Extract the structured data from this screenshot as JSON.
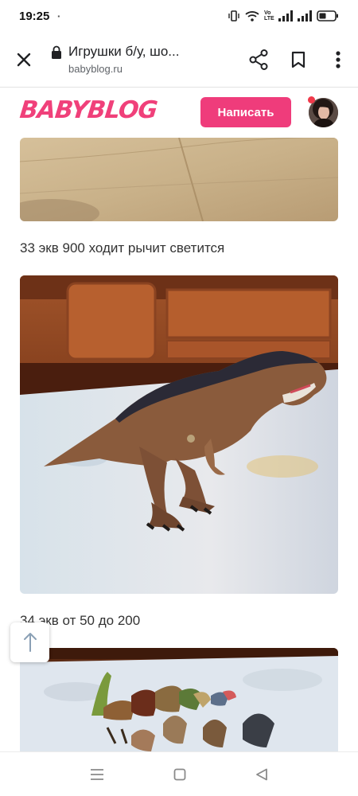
{
  "status_bar": {
    "time": "19:25",
    "notification_glyph": "▪",
    "volte_label": "Vo LTE",
    "icons": [
      "vibrate-icon",
      "wifi-icon",
      "signal-icon",
      "signal-icon",
      "battery-icon"
    ]
  },
  "browser": {
    "page_title": "Игрушки б/у, шо...",
    "domain": "babyblog.ru",
    "icons": [
      "close-icon",
      "lock-icon",
      "share-icon",
      "bookmark-icon",
      "more-vertical-icon"
    ]
  },
  "site_header": {
    "logo_text": "BABYBLOG",
    "write_button_label": "Написать",
    "brand_color": "#ef3c7b",
    "notification_dot_color": "#f0394a"
  },
  "content": {
    "captions": [
      "33 экв 900 ходит рычит светится",
      "34 экв от 50 до 200"
    ]
  },
  "nav_bar": {
    "icons": [
      "menu-icon",
      "home-square-icon",
      "back-triangle-icon"
    ]
  }
}
